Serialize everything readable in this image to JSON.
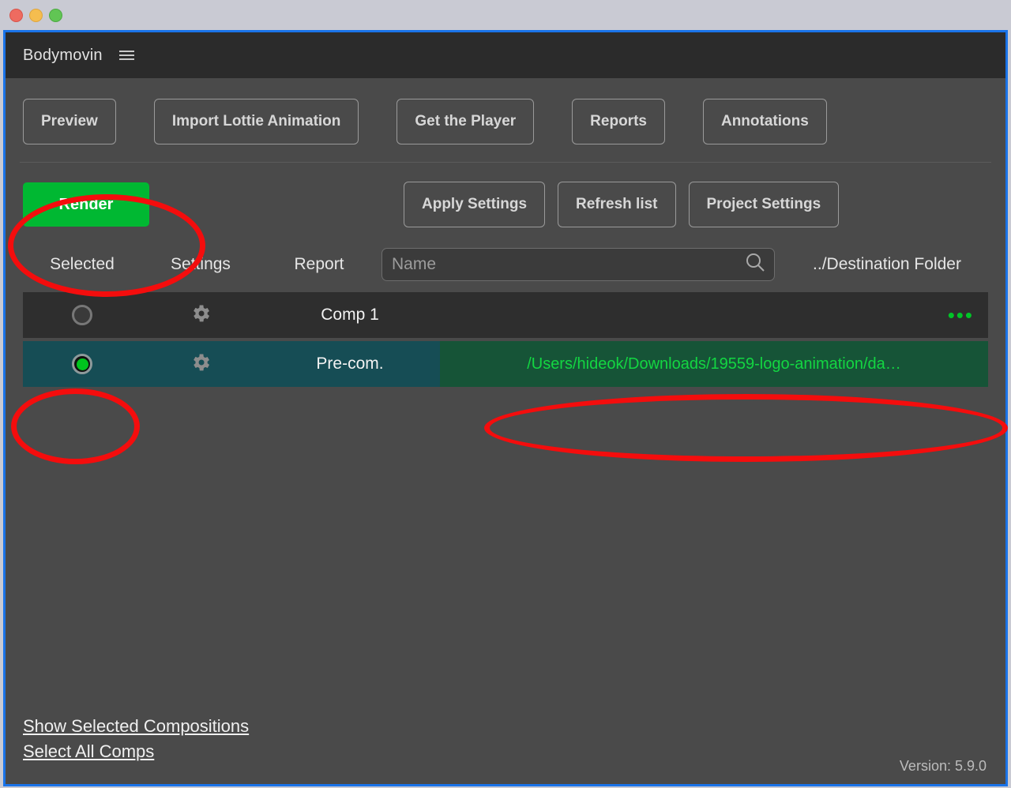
{
  "window": {
    "traffic_lights": [
      "close",
      "minimize",
      "maximize"
    ]
  },
  "header": {
    "title": "Bodymovin",
    "menu_icon": "hamburger-icon"
  },
  "toolbar": {
    "buttons": [
      {
        "label": "Preview"
      },
      {
        "label": "Import Lottie Animation"
      },
      {
        "label": "Get the Player"
      },
      {
        "label": "Reports"
      },
      {
        "label": "Annotations"
      }
    ]
  },
  "render_row": {
    "render_label": "Render",
    "render_color": "#00b832",
    "buttons": [
      {
        "label": "Apply Settings"
      },
      {
        "label": "Refresh list"
      },
      {
        "label": "Project Settings"
      }
    ]
  },
  "columns": {
    "selected": "Selected",
    "settings": "Settings",
    "report": "Report",
    "destination": "../Destination Folder"
  },
  "search": {
    "value": "",
    "placeholder": "Name",
    "icon": "search-icon"
  },
  "compositions": [
    {
      "name": "Comp 1",
      "selected": false,
      "settings_icon": "gear-icon",
      "destination": "",
      "menu": "•••"
    },
    {
      "name": "Pre-com.",
      "selected": true,
      "settings_icon": "gear-icon",
      "destination": "/Users/hideok/Downloads/19559-logo-animation/da…",
      "menu": ""
    }
  ],
  "footer": {
    "show_selected": "Show Selected Compositions",
    "select_all": "Select All Comps",
    "version": "Version: 5.9.0"
  },
  "annotations": {
    "color": "#f40d0d",
    "shapes": [
      "ellipse-render-button",
      "ellipse-selected-radio",
      "ellipse-destination-path"
    ]
  }
}
